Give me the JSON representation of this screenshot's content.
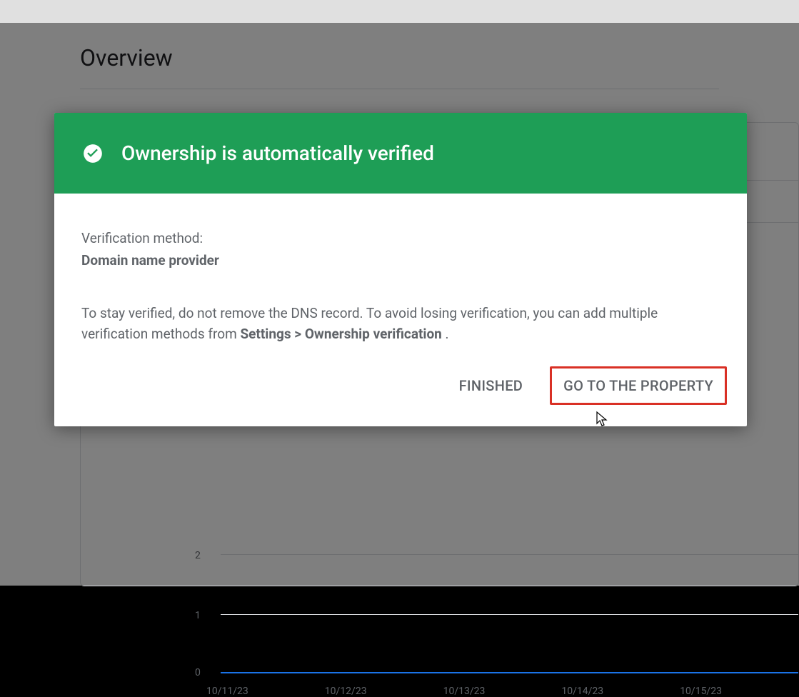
{
  "page": {
    "title": "Overview"
  },
  "chart_data": {
    "type": "line",
    "x": [
      "10/11/23",
      "10/12/23",
      "10/13/23",
      "10/14/23",
      "10/15/23"
    ],
    "values": [
      0,
      0,
      0,
      0,
      0
    ],
    "yticks": [
      0,
      1,
      2
    ],
    "ylim": [
      0,
      2
    ]
  },
  "dialog": {
    "header_title": "Ownership is automatically verified",
    "method_label": "Verification method:",
    "method_value": "Domain name provider",
    "body_prefix": "To stay verified, do not remove the DNS record. To avoid losing verification, you can add multiple verification methods from ",
    "body_bold": "Settings > Ownership verification",
    "body_suffix": " .",
    "finished_label": "FINISHED",
    "goto_label": "GO TO THE PROPERTY"
  },
  "chart_axes": {
    "y0": "0",
    "y1": "1",
    "y2": "2",
    "x0": "10/11/23",
    "x1": "10/12/23",
    "x2": "10/13/23",
    "x3": "10/14/23",
    "x4": "10/15/23"
  }
}
